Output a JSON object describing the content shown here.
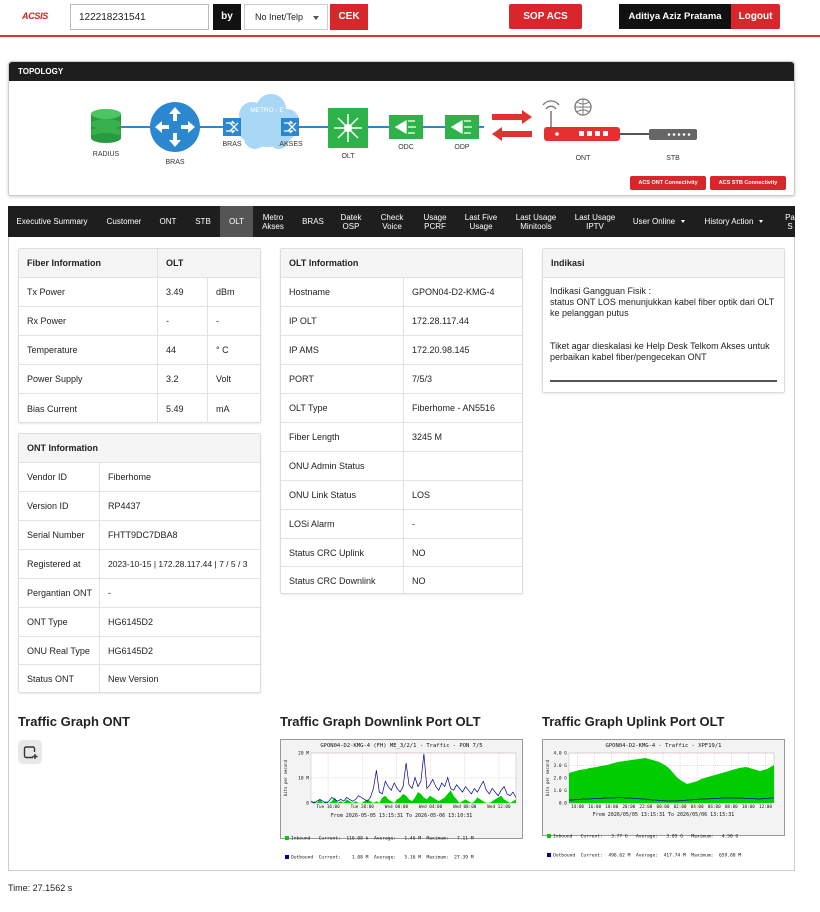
{
  "header": {
    "logo": "ACSIS",
    "search_value": "122218231541",
    "by_label": "by",
    "select_value": "No Inet/Telp",
    "cek_label": "CEK",
    "sop_label": "SOP ACS",
    "user_name": "Aditiya Aziz Pratama",
    "logout_label": "Logout"
  },
  "topology": {
    "title": "TOPOLOGY",
    "nodes": {
      "radius": "RADIUS",
      "bras": "BRAS",
      "metro": "METRO - E",
      "bras2": "BRAS",
      "akses": "AKSES",
      "olt": "OLT",
      "odc": "ODC",
      "odp": "ODP",
      "ont": "ONT",
      "stb": "STB"
    },
    "ont_conn": "ACS ONT Connectivity",
    "stb_conn": "ACS STB Connectivity"
  },
  "nav": {
    "items": [
      {
        "label": "Executive Summary"
      },
      {
        "label": "Customer"
      },
      {
        "label": "ONT"
      },
      {
        "label": "STB"
      },
      {
        "label": "OLT"
      },
      {
        "label": "Metro Akses",
        "l1": "Metro",
        "l2": "Akses"
      },
      {
        "label": "BRAS"
      },
      {
        "label": "Datek OSP",
        "l1": "Datek",
        "l2": "OSP"
      },
      {
        "label": "Check Voice",
        "l1": "Check",
        "l2": "Voice"
      },
      {
        "label": "Usage PCRF",
        "l1": "Usage",
        "l2": "PCRF"
      },
      {
        "label": "Last Five Usage",
        "l1": "Last Five",
        "l2": "Usage"
      },
      {
        "label": "Last Usage Minitools",
        "l1": "Last Usage",
        "l2": "Minitools"
      },
      {
        "label": "Last Usage IPTV",
        "l1": "Last Usage",
        "l2": "IPTV"
      },
      {
        "label": "User Online"
      },
      {
        "label": "History Action"
      },
      {
        "label": "Pa S",
        "l1": "Pa",
        "l2": "S"
      }
    ]
  },
  "fiber": {
    "header": [
      "Fiber Information",
      "OLT"
    ],
    "rows": [
      [
        "Tx Power",
        "3.49",
        "dBm"
      ],
      [
        "Rx Power",
        "-",
        "-"
      ],
      [
        "Temperature",
        "44",
        "° C"
      ],
      [
        "Power Supply",
        "3.2",
        "Volt"
      ],
      [
        "Bias Current",
        "5.49",
        "mA"
      ]
    ]
  },
  "ont_info": {
    "header": "ONT Information",
    "rows": [
      [
        "Vendor ID",
        "Fiberhome"
      ],
      [
        "Version ID",
        "RP4437"
      ],
      [
        "Serial Number",
        "FHTT9DC7DBA8"
      ],
      [
        "Registered at",
        "2023-10-15 | 172.28.117.44 | 7 / 5 / 3"
      ],
      [
        "Pergantian ONT",
        "-"
      ],
      [
        "ONT Type",
        "HG6145D2"
      ],
      [
        "ONU Real Type",
        "HG6145D2"
      ],
      [
        "Status ONT",
        "New Version"
      ]
    ]
  },
  "olt_info": {
    "header": "OLT Information",
    "rows": [
      [
        "Hostname",
        "GPON04-D2-KMG-4"
      ],
      [
        "IP OLT",
        "172.28.117.44"
      ],
      [
        "IP AMS",
        "172.20.98.145"
      ],
      [
        "PORT",
        "7/5/3"
      ],
      [
        "OLT Type",
        "Fiberhome - AN5516"
      ],
      [
        "Fiber Length",
        "3245 M"
      ],
      [
        "ONU Admin Status",
        ""
      ],
      [
        "ONU Link Status",
        "LOS"
      ],
      [
        "LOSi Alarm",
        "-"
      ],
      [
        "Status CRC Uplink",
        "NO"
      ],
      [
        "Status CRC Downlink",
        "NO"
      ]
    ]
  },
  "indikasi": {
    "header": "Indikasi",
    "line1": "Indikasi Gangguan Fisik :",
    "line2": "status ONT LOS menunjukkan kabel fiber optik dari OLT ke pelanggan putus",
    "line3": "Tiket agar dieskalasi ke Help Desk Telkom Akses untuk perbaikan kabel fiber/pengecekan ONT"
  },
  "traffic": {
    "ont_title": "Traffic Graph ONT",
    "down_title": "Traffic Graph Downlink Port OLT",
    "up_title": "Traffic Graph Uplink Port OLT",
    "down_graph": {
      "title": "GPON04-D2-KMG-4 (FH) ME_3/2/1 - Traffic - PON 7/5",
      "ylabel": "bits per second",
      "yticks": [
        "20 M",
        "10 M",
        "0"
      ],
      "xticks": [
        "Tue 16:00",
        "Tue 20:00",
        "Wed 00:00",
        "Wed 04:00",
        "Wed 08:00",
        "Wed 12:00"
      ],
      "from": "From 2026-05-05 13:15:31 To 2026-05-06 13:10:31",
      "in_line": "Inbound   Current:  116.08 k  Average:   1.46 M  Maximum:   7.11 M",
      "out_line": "Outbound  Current:    1.08 M  Average:   5.16 M  Maximum:  27.39 M"
    },
    "up_graph": {
      "title": "GPON04-D2-KMG-4 - Traffic - XPF19/1",
      "ylabel": "bits per second",
      "yticks": [
        "4.0 G",
        "3.0 G",
        "2.0 G",
        "1.0 G",
        "0.0"
      ],
      "xticks": [
        "14:00",
        "16:00",
        "18:00",
        "20:00",
        "22:00",
        "00:00",
        "02:00",
        "04:00",
        "06:00",
        "08:00",
        "10:00",
        "12:00"
      ],
      "from": "From 2026/05/05 13:15:31 To 2026/05/06 13:15:31",
      "in_line": "Inbound   Current:   3.77 G   Average:   3.05 G   Maximum:   4.50 G",
      "out_line": "Outbound  Current:  496.62 M  Average:  417.74 M  Maximum:  659.80 M"
    }
  },
  "footer": {
    "time": "Time: 27.1562 s"
  },
  "colors": {
    "accent": "#d9262c",
    "dark": "#1e1e1e",
    "green": "#2db34a",
    "blue": "#2b87cf",
    "graph_in": "#00cc00",
    "graph_out": "#000099"
  }
}
